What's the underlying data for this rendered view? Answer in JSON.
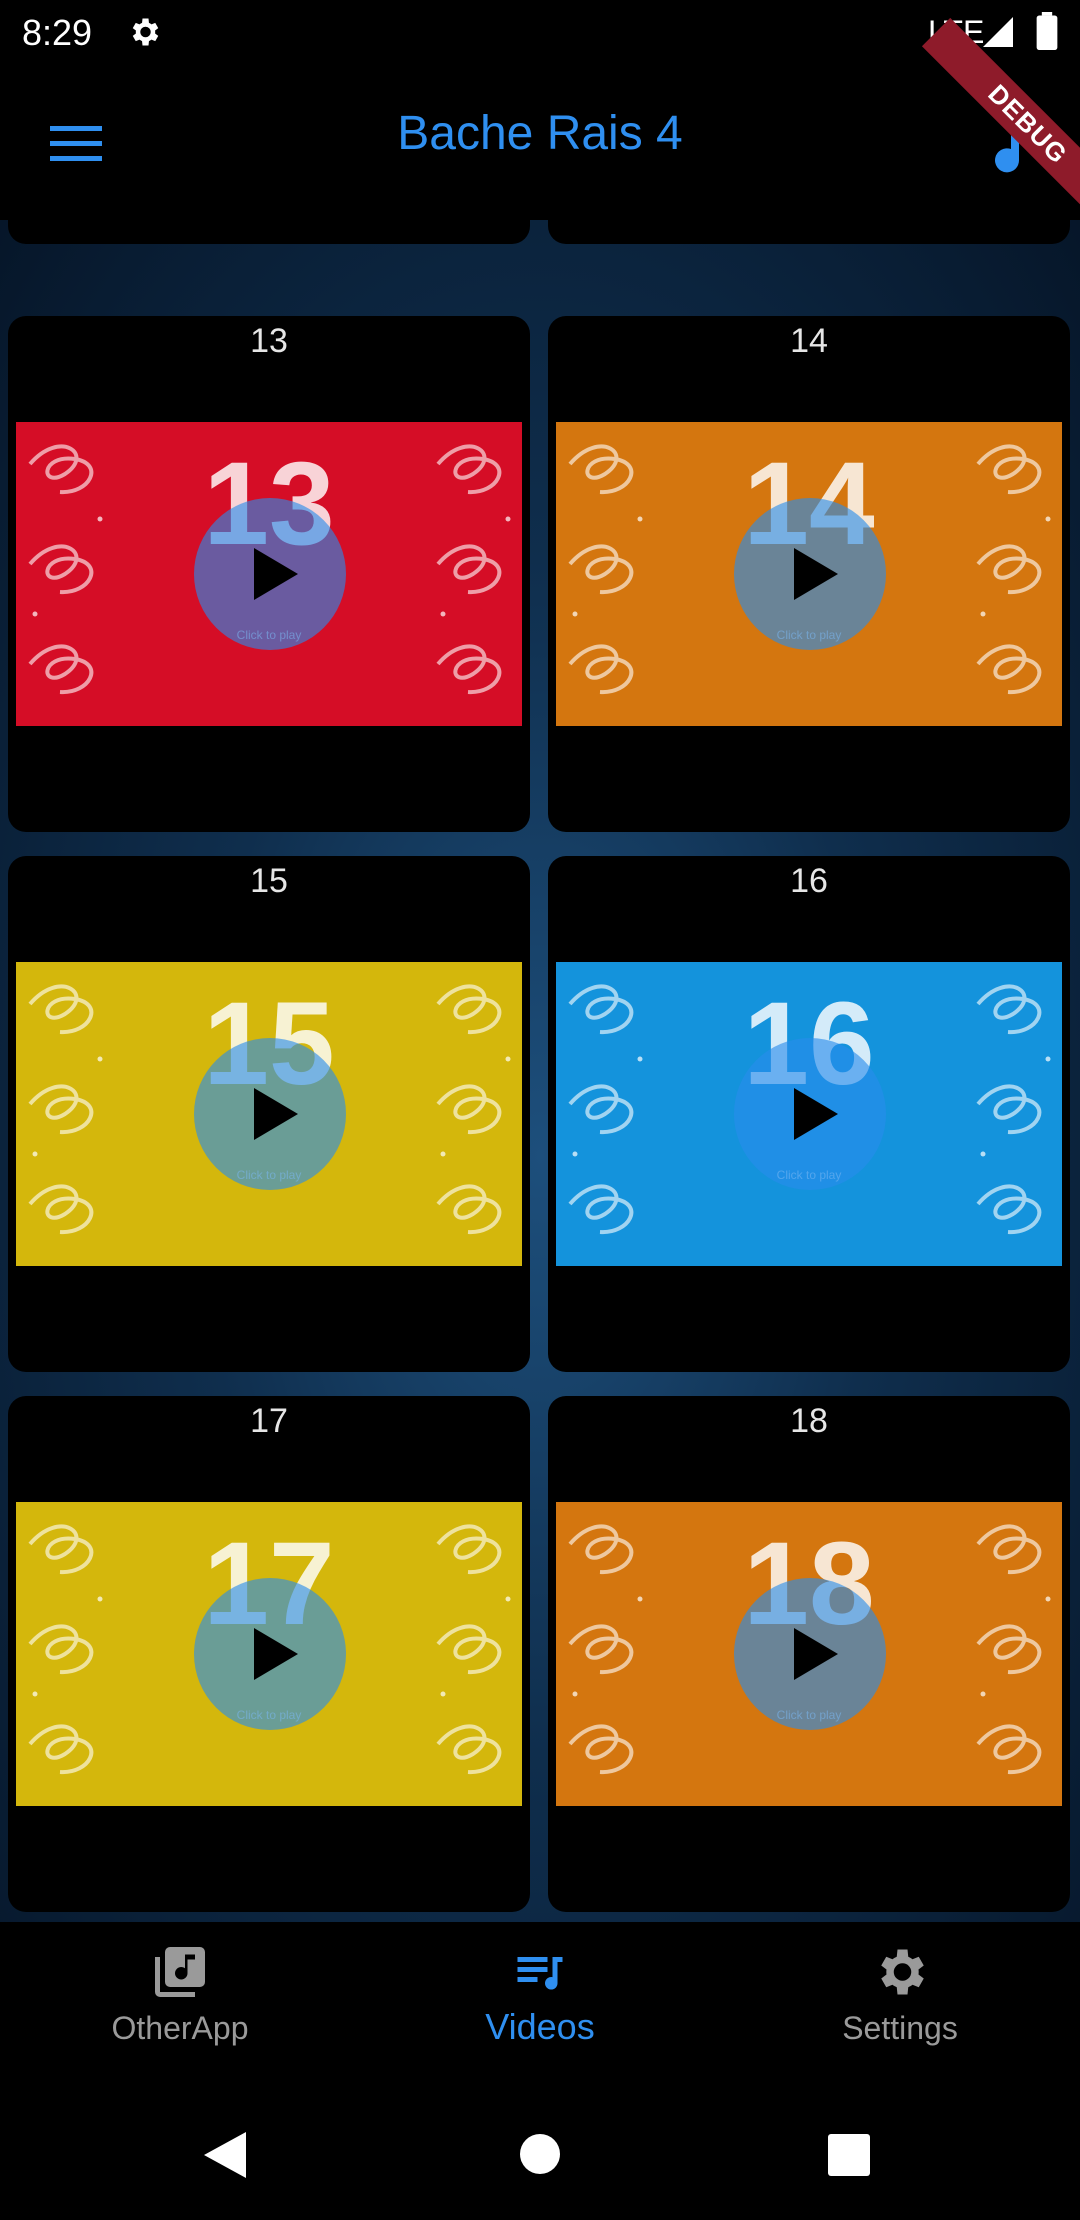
{
  "status_bar": {
    "time": "8:29",
    "network": "LTE",
    "debug_label": "DEBUG"
  },
  "app_bar": {
    "title": "Bache Rais 4",
    "menu_icon": "hamburger-menu-icon",
    "music_icon": "music-note-icon"
  },
  "videos": [
    {
      "label": "13",
      "thumb_text": "13",
      "color": "#d50d26",
      "caption": "Click to play"
    },
    {
      "label": "14",
      "thumb_text": "14",
      "color": "#d4760f",
      "caption": "Click to play"
    },
    {
      "label": "15",
      "thumb_text": "15",
      "color": "#d4b70c",
      "caption": "Click to play"
    },
    {
      "label": "16",
      "thumb_text": "16",
      "color": "#1493dc",
      "caption": "Click to play"
    },
    {
      "label": "17",
      "thumb_text": "17",
      "color": "#d4b70c",
      "caption": "Click to play"
    },
    {
      "label": "18",
      "thumb_text": "18",
      "color": "#d4760f",
      "caption": "Click to play"
    }
  ],
  "bottom_nav": {
    "items": [
      {
        "label": "OtherApp",
        "icon": "music-library-icon",
        "active": false
      },
      {
        "label": "Videos",
        "icon": "playlist-music-icon",
        "active": true
      },
      {
        "label": "Settings",
        "icon": "gear-icon",
        "active": false
      }
    ]
  },
  "colors": {
    "accent": "#2f8ff0",
    "inactive": "#9a9a9a",
    "background": "#000000"
  }
}
